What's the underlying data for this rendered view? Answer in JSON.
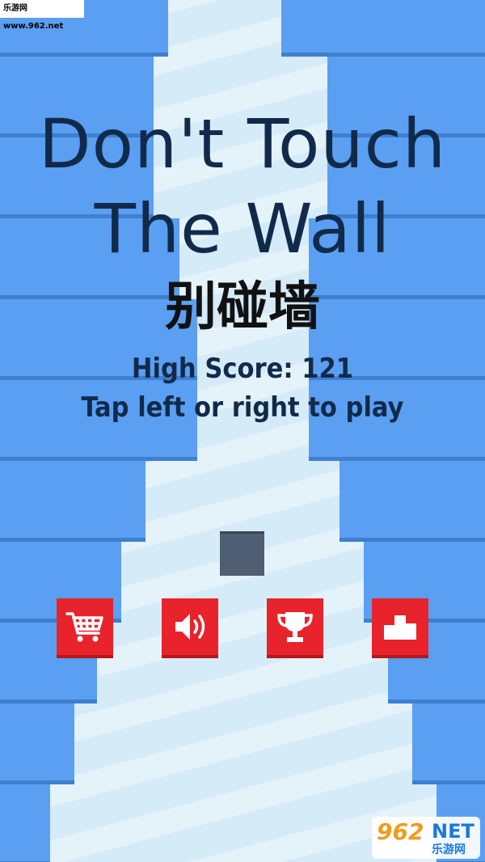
{
  "watermark_top": "乐游网 www.962.net",
  "title": {
    "line1": "Don't Touch",
    "line2": "The Wall"
  },
  "subtitle_cn": "别碰墙",
  "high_score_text": "High Score: 121",
  "instruction_text": "Tap left or right to play",
  "buttons": [
    {
      "name": "shop",
      "icon": "cart-icon"
    },
    {
      "name": "sound",
      "icon": "speaker-icon"
    },
    {
      "name": "achievements",
      "icon": "trophy-icon"
    },
    {
      "name": "leaderboard",
      "icon": "podium-icon"
    }
  ],
  "watermark_bottom": {
    "number": "962",
    "brand": "NET",
    "caption": "乐游网"
  },
  "colors": {
    "wall": "#5a9ff2",
    "wall_edge": "#3e7fd0",
    "corridor": "#d6ebf8",
    "text": "#122a4a",
    "button": "#e8232b",
    "player": "#4f5e72"
  }
}
